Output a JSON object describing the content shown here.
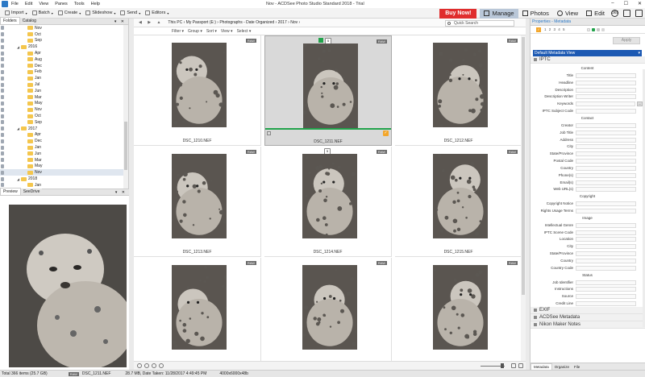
{
  "window": {
    "title": "Nov - ACDSee Photo Studio Standard 2018 - Trial",
    "menu": [
      "File",
      "Edit",
      "View",
      "Panes",
      "Tools",
      "Help"
    ]
  },
  "toolbar": {
    "items": [
      "Import",
      "Batch",
      "Create",
      "Slideshow",
      "Send",
      "Editors"
    ],
    "buy_now": "Buy Now!",
    "modes": [
      "Manage",
      "Photos",
      "View",
      "Edit"
    ],
    "active_mode": "Manage",
    "round_icon": "365"
  },
  "left_panel": {
    "tabs": [
      "Folders",
      "Catalog"
    ],
    "tree": [
      {
        "label": "Nov",
        "indent": 2
      },
      {
        "label": "Oct",
        "indent": 2
      },
      {
        "label": "Sep",
        "indent": 2
      },
      {
        "label": "2016",
        "indent": 1,
        "expanded": true
      },
      {
        "label": "Apr",
        "indent": 2
      },
      {
        "label": "Aug",
        "indent": 2
      },
      {
        "label": "Dec",
        "indent": 2
      },
      {
        "label": "Feb",
        "indent": 2
      },
      {
        "label": "Jan",
        "indent": 2
      },
      {
        "label": "Jul",
        "indent": 2
      },
      {
        "label": "Jun",
        "indent": 2
      },
      {
        "label": "Mar",
        "indent": 2
      },
      {
        "label": "May",
        "indent": 2
      },
      {
        "label": "Nov",
        "indent": 2
      },
      {
        "label": "Oct",
        "indent": 2
      },
      {
        "label": "Sep",
        "indent": 2
      },
      {
        "label": "2017",
        "indent": 1,
        "expanded": true
      },
      {
        "label": "Apr",
        "indent": 2
      },
      {
        "label": "Dec",
        "indent": 2
      },
      {
        "label": "Jan",
        "indent": 2
      },
      {
        "label": "Jun",
        "indent": 2
      },
      {
        "label": "Mar",
        "indent": 2
      },
      {
        "label": "May",
        "indent": 2
      },
      {
        "label": "Nov",
        "indent": 2,
        "selected": true
      },
      {
        "label": "2018",
        "indent": 1,
        "expanded": true
      },
      {
        "label": "Jan",
        "indent": 2
      }
    ],
    "preview_tabs": [
      "Preview",
      "SeeDrive"
    ]
  },
  "address": {
    "breadcrumb": [
      "This PC",
      "My Passport (E:)",
      "Photographs - Date Organized",
      "2017",
      "Nov"
    ],
    "search_placeholder": "Quick Search"
  },
  "filterbar": [
    "Filter",
    "Group",
    "Sort",
    "View",
    "Select"
  ],
  "files": [
    {
      "name": "DSC_1210.NEF",
      "badge": "RAW"
    },
    {
      "name": "DSC_1211.NEF",
      "badge": "RAW",
      "selected": true,
      "top_badge": "5"
    },
    {
      "name": "DSC_1212.NEF",
      "badge": "RAW"
    },
    {
      "name": "DSC_1213.NEF",
      "badge": "RAW"
    },
    {
      "name": "DSC_1214.NEF",
      "badge": "RAW",
      "top_badge": "5"
    },
    {
      "name": "DSC_1215.NEF",
      "badge": "RAW"
    },
    {
      "name": "",
      "badge": "RAW"
    },
    {
      "name": "",
      "badge": "RAW"
    },
    {
      "name": "",
      "badge": "RAW"
    }
  ],
  "right_panel": {
    "header": "Properties - Metadata",
    "tool_numbers": "1 2 3 4 5",
    "apply": "Apply",
    "metadata_view": "Default Metadata View",
    "sections": [
      "IPTC",
      "EXIF",
      "ACDSee Metadata",
      "Nikon Maker Notes"
    ],
    "iptc_rows": [
      {
        "type": "header",
        "label": "Content"
      },
      {
        "type": "field",
        "label": "Title"
      },
      {
        "type": "field",
        "label": "Headline"
      },
      {
        "type": "field",
        "label": "Description"
      },
      {
        "type": "field",
        "label": "Description Writer"
      },
      {
        "type": "field",
        "label": "Keywords",
        "button": "..."
      },
      {
        "type": "field",
        "label": "IPTC Subject Code"
      },
      {
        "type": "header",
        "label": "Contact"
      },
      {
        "type": "field",
        "label": "Creator"
      },
      {
        "type": "field",
        "label": "Job Title"
      },
      {
        "type": "field",
        "label": "Address"
      },
      {
        "type": "field",
        "label": "City"
      },
      {
        "type": "field",
        "label": "State/Province"
      },
      {
        "type": "field",
        "label": "Postal Code"
      },
      {
        "type": "field",
        "label": "Country"
      },
      {
        "type": "field",
        "label": "Phone(s)"
      },
      {
        "type": "field",
        "label": "Email(s)"
      },
      {
        "type": "field",
        "label": "Web URL(s)"
      },
      {
        "type": "header",
        "label": "Copyright"
      },
      {
        "type": "field",
        "label": "Copyright Notice"
      },
      {
        "type": "field",
        "label": "Rights Usage Terms"
      },
      {
        "type": "header",
        "label": "Image"
      },
      {
        "type": "field",
        "label": "Intellectual Genre"
      },
      {
        "type": "field",
        "label": "IPTC Scene Code"
      },
      {
        "type": "field",
        "label": "Location"
      },
      {
        "type": "field",
        "label": "City"
      },
      {
        "type": "field",
        "label": "State/Province"
      },
      {
        "type": "field",
        "label": "Country"
      },
      {
        "type": "field",
        "label": "Country Code"
      },
      {
        "type": "header",
        "label": "Status"
      },
      {
        "type": "field",
        "label": "Job Identifier"
      },
      {
        "type": "field",
        "label": "Instructions"
      },
      {
        "type": "field",
        "label": "Source"
      },
      {
        "type": "field",
        "label": "Credit Line"
      }
    ],
    "bottom_tabs": [
      "Metadata",
      "Organize",
      "File"
    ]
  },
  "status": {
    "total": "Total 366 items (25.7 GB)",
    "badge": "RAW",
    "file": "DSC_1211.NEF",
    "size": "28.7 MB, Date Taken: 11/28/2017 4:49:45 PM",
    "dims": "4000x6000x48b"
  },
  "colors": {
    "accent": "#1c59b3",
    "buy_now": "#e02d2d",
    "folder": "#f4c64d",
    "tag_green": "#22a34b",
    "check_orange": "#f3a62a",
    "active_mode": "#b9c7d8"
  }
}
